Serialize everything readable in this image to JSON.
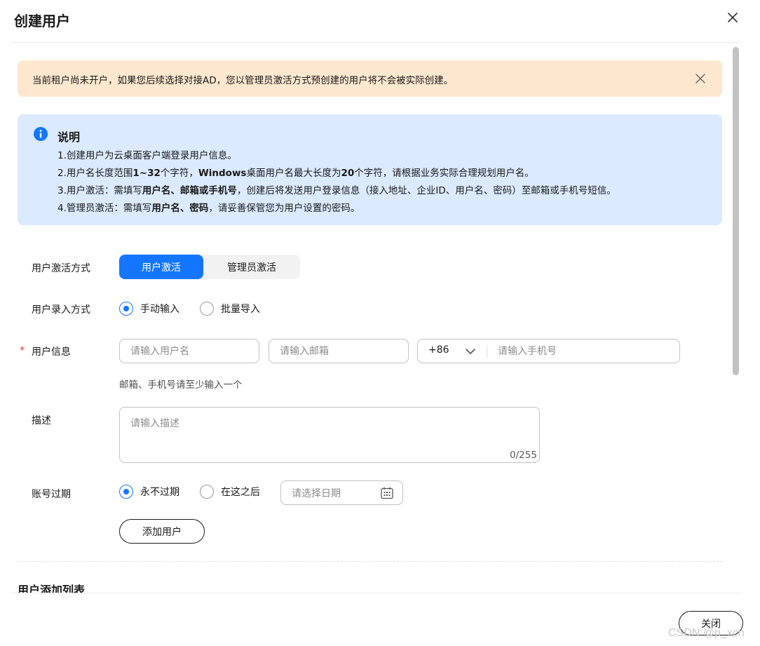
{
  "dialog": {
    "title": "创建用户",
    "close_icon": "close-icon"
  },
  "warning": {
    "text": "当前租户尚未开户，如果您后续选择对接AD，您以管理员激活方式预创建的用户将不会被实际创建。",
    "close_icon": "close-icon"
  },
  "info": {
    "icon": "info-icon",
    "title": "说明",
    "lines": [
      [
        {
          "t": "1.创建用户为云桌面客户端登录用户信息。",
          "b": false
        }
      ],
      [
        {
          "t": "2.用户名长度范围",
          "b": false
        },
        {
          "t": "1~32",
          "b": true
        },
        {
          "t": "个字符，",
          "b": false
        },
        {
          "t": "Windows",
          "b": true
        },
        {
          "t": "桌面用户名最大长度为",
          "b": false
        },
        {
          "t": "20",
          "b": true
        },
        {
          "t": "个字符，请根据业务实际合理规划用户名。",
          "b": false
        }
      ],
      [
        {
          "t": "3.用户激活：需填写",
          "b": false
        },
        {
          "t": "用户名、邮箱或手机号",
          "b": true
        },
        {
          "t": "，创建后将发送用户登录信息（接入地址、企业ID、用户名、密码）至邮箱或手机号短信。",
          "b": false
        }
      ],
      [
        {
          "t": "4.管理员激活：需填写",
          "b": false
        },
        {
          "t": "用户名、密码",
          "b": true
        },
        {
          "t": "，请妥善保管您为用户设置的密码。",
          "b": false
        }
      ]
    ]
  },
  "form": {
    "activation": {
      "label": "用户激活方式",
      "options": [
        "用户激活",
        "管理员激活"
      ],
      "selected": "用户激活"
    },
    "entry": {
      "label": "用户录入方式",
      "options": [
        "手动输入",
        "批量导入"
      ],
      "selected": "手动输入"
    },
    "user_info": {
      "required_mark": "*",
      "label": "用户信息",
      "username_placeholder": "请输入用户名",
      "email_placeholder": "请输入邮箱",
      "country_code": "+86",
      "phone_placeholder": "请输入手机号",
      "hint": "邮箱、手机号请至少输入一个"
    },
    "description": {
      "label": "描述",
      "placeholder": "请输入描述",
      "counter": "0/255"
    },
    "expiry": {
      "label": "账号过期",
      "options": [
        "永不过期",
        "在这之后"
      ],
      "selected": "永不过期",
      "date_placeholder": "请选择日期"
    },
    "add_user_label": "添加用户"
  },
  "list_section": {
    "title": "用户添加列表"
  },
  "footer": {
    "close_label": "关闭"
  },
  "watermark": "CSDN @p_xcn",
  "colors": {
    "primary": "#1476ff",
    "warning_bg": "#fde8cf",
    "info_bg": "#dbeafe",
    "required": "#e33"
  }
}
